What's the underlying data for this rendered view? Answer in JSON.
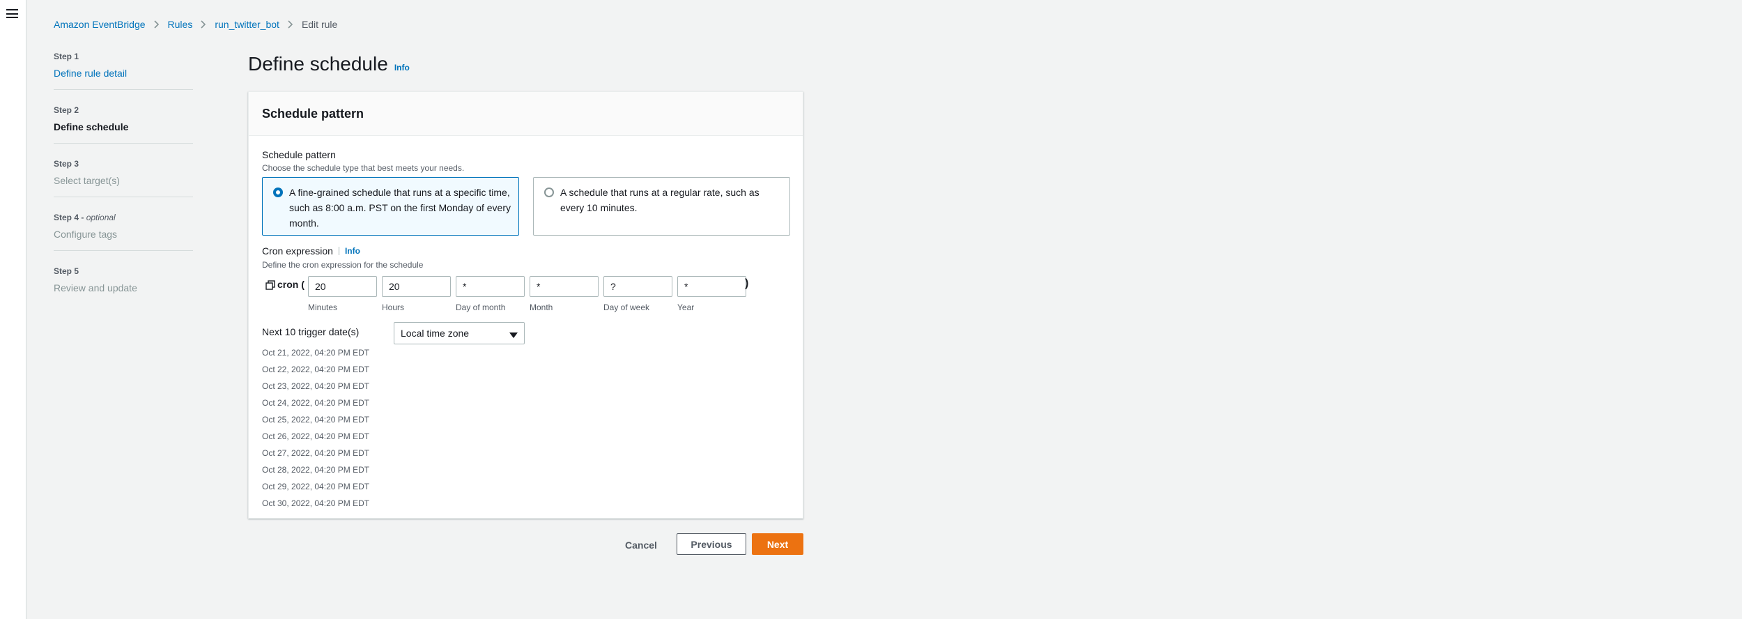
{
  "breadcrumb": {
    "items": [
      {
        "label": "Amazon EventBridge"
      },
      {
        "label": "Rules"
      },
      {
        "label": "run_twitter_bot"
      }
    ],
    "current": "Edit rule"
  },
  "steps": [
    {
      "step": "Step 1",
      "optional": "",
      "title": "Define rule detail",
      "state": "done"
    },
    {
      "step": "Step 2",
      "optional": "",
      "title": "Define schedule",
      "state": "active"
    },
    {
      "step": "Step 3",
      "optional": "",
      "title": "Select target(s)",
      "state": "disabled"
    },
    {
      "step": "Step 4 - ",
      "optional": "optional",
      "title": "Configure tags",
      "state": "disabled"
    },
    {
      "step": "Step 5",
      "optional": "",
      "title": "Review and update",
      "state": "disabled"
    }
  ],
  "page": {
    "title": "Define schedule",
    "info": "Info"
  },
  "schedule": {
    "header": "Schedule pattern",
    "label": "Schedule pattern",
    "description": "Choose the schedule type that best meets your needs.",
    "options": [
      {
        "text": "A fine-grained schedule that runs at a specific time, such as 8:00 a.m. PST on the first Monday of every month.",
        "selected": true
      },
      {
        "text": "A schedule that runs at a regular rate, such as every 10 minutes.",
        "selected": false
      }
    ]
  },
  "cron": {
    "label": "Cron expression",
    "info": "Info",
    "description": "Define the cron expression for the schedule",
    "prefix": "cron (",
    "suffix": ")",
    "fields": [
      {
        "value": "20",
        "caption": "Minutes"
      },
      {
        "value": "20",
        "caption": "Hours"
      },
      {
        "value": "*",
        "caption": "Day of month"
      },
      {
        "value": "*",
        "caption": "Month"
      },
      {
        "value": "?",
        "caption": "Day of week"
      },
      {
        "value": "*",
        "caption": "Year"
      }
    ]
  },
  "triggers": {
    "label": "Next 10 trigger date(s)",
    "timezone": "Local time zone",
    "dates": [
      "Oct 21, 2022, 04:20 PM EDT",
      "Oct 22, 2022, 04:20 PM EDT",
      "Oct 23, 2022, 04:20 PM EDT",
      "Oct 24, 2022, 04:20 PM EDT",
      "Oct 25, 2022, 04:20 PM EDT",
      "Oct 26, 2022, 04:20 PM EDT",
      "Oct 27, 2022, 04:20 PM EDT",
      "Oct 28, 2022, 04:20 PM EDT",
      "Oct 29, 2022, 04:20 PM EDT",
      "Oct 30, 2022, 04:20 PM EDT"
    ]
  },
  "actions": {
    "cancel": "Cancel",
    "previous": "Previous",
    "next": "Next"
  },
  "icons": {
    "menu": "hamburger-icon",
    "separator": "chevron-right-icon",
    "copy": "copy-icon",
    "dropdown": "caret-down-icon"
  },
  "colors": {
    "link": "#0073bb",
    "primary": "#ec7211",
    "background": "#f2f3f3"
  }
}
